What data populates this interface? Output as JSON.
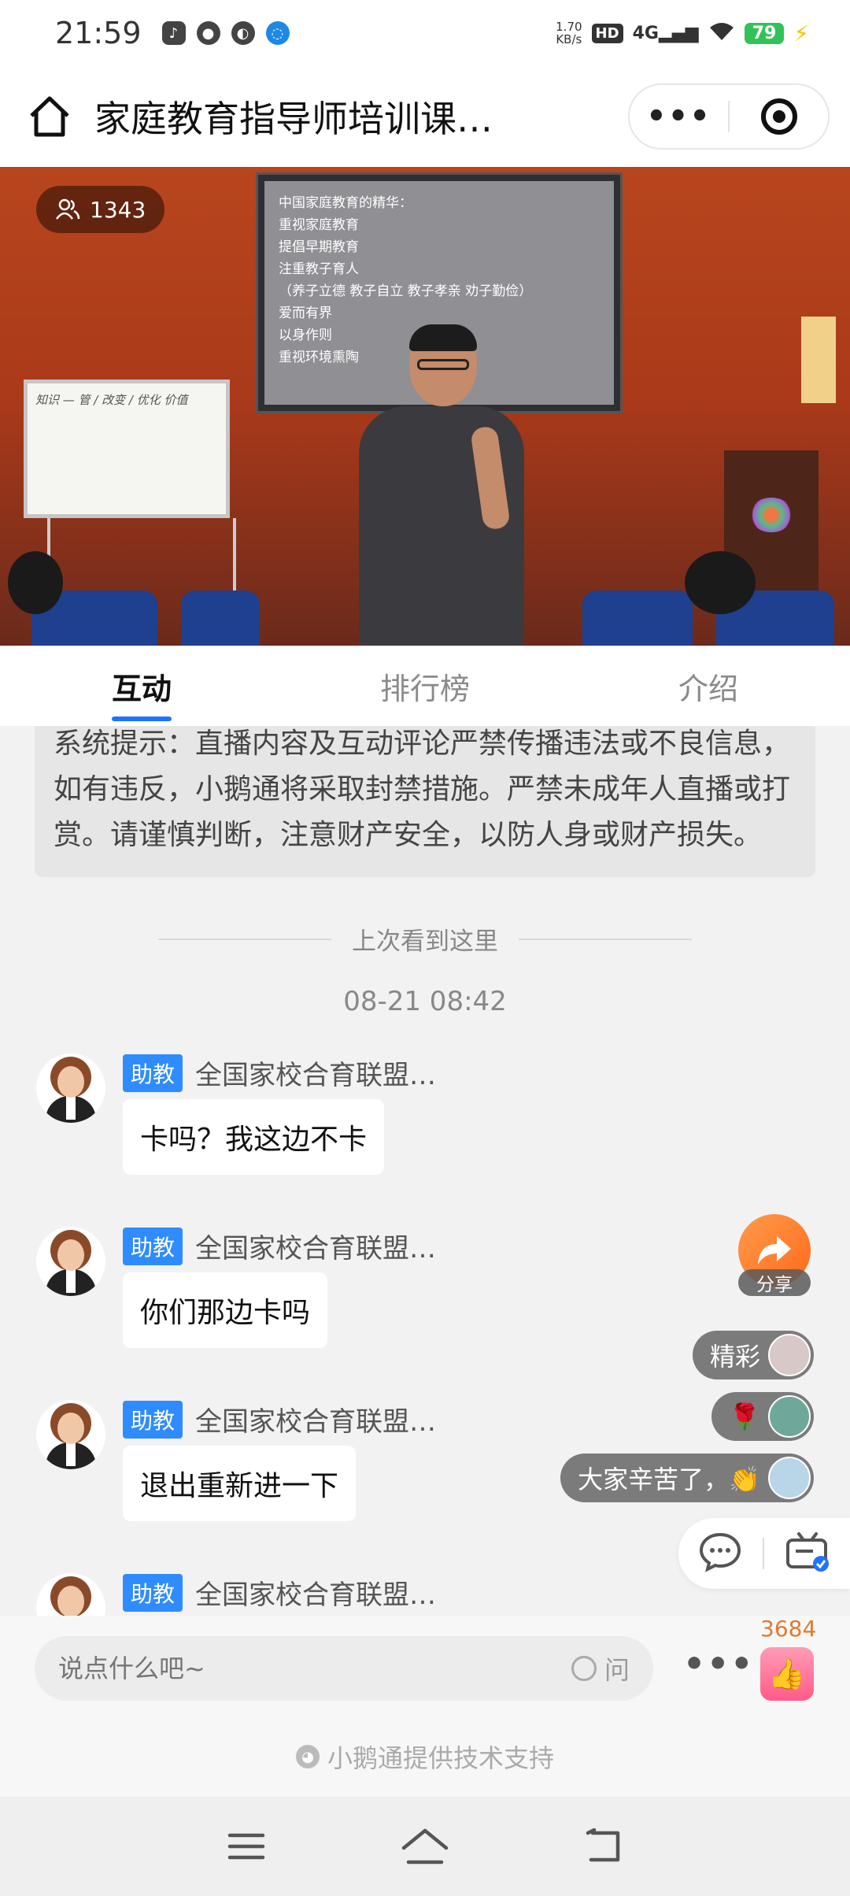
{
  "status_bar": {
    "time": "21:59",
    "net_speed_value": "1.70",
    "net_speed_unit": "KB/s",
    "hd": "HD",
    "network": "4G",
    "battery": "79"
  },
  "title_bar": {
    "title": "家庭教育指导师培训课…"
  },
  "video": {
    "viewer_count": "1343",
    "screen_lines": [
      "中国家庭教育的精华：",
      "",
      "重视家庭教育",
      "提倡早期教育",
      "注重教子育人",
      "（养子立德 教子自立 教子孝亲 劝子勤俭）",
      "爱而有界",
      "以身作则",
      "重视环境熏陶"
    ],
    "whiteboard_text": "知识 — 管 / 改变 / 优化 价值"
  },
  "tabs": [
    {
      "label": "互动"
    },
    {
      "label": "排行榜"
    },
    {
      "label": "介绍"
    }
  ],
  "chat": {
    "notice_text": "系统提示：直播内容及互动评论严禁传播违法或不良信息，如有违反，小鹅通将采取封禁措施。严禁未成年人直播或打赏。请谨慎判断，注意财产安全，以防人身或财产损失。",
    "divider_text": "上次看到这里",
    "timestamp": "08-21 08:42",
    "messages": [
      {
        "role": "助教",
        "sender": "全国家校合育联盟…",
        "text": "卡吗？我这边不卡"
      },
      {
        "role": "助教",
        "sender": "全国家校合育联盟…",
        "text": "你们那边卡吗"
      },
      {
        "role": "助教",
        "sender": "全国家校合育联盟…",
        "text": "退出重新进一下"
      },
      {
        "role": "助教",
        "sender": "全国家校合育联盟…",
        "text": ""
      }
    ]
  },
  "floating": {
    "share_label": "分享",
    "comments": [
      {
        "text": "精彩"
      },
      {
        "text": "🌹"
      },
      {
        "text": "大家辛苦了，👏"
      }
    ]
  },
  "input_bar": {
    "placeholder": "说点什么吧~",
    "ask_label": "问",
    "like_count": "3684"
  },
  "footer": {
    "powered_by": "小鹅通提供技术支持"
  },
  "colors": {
    "accent": "#1e74ff",
    "badge": "#2f8cff",
    "share": "#ff7a2a",
    "like": "#ff5a8a",
    "like_count": "#e07a2e"
  }
}
